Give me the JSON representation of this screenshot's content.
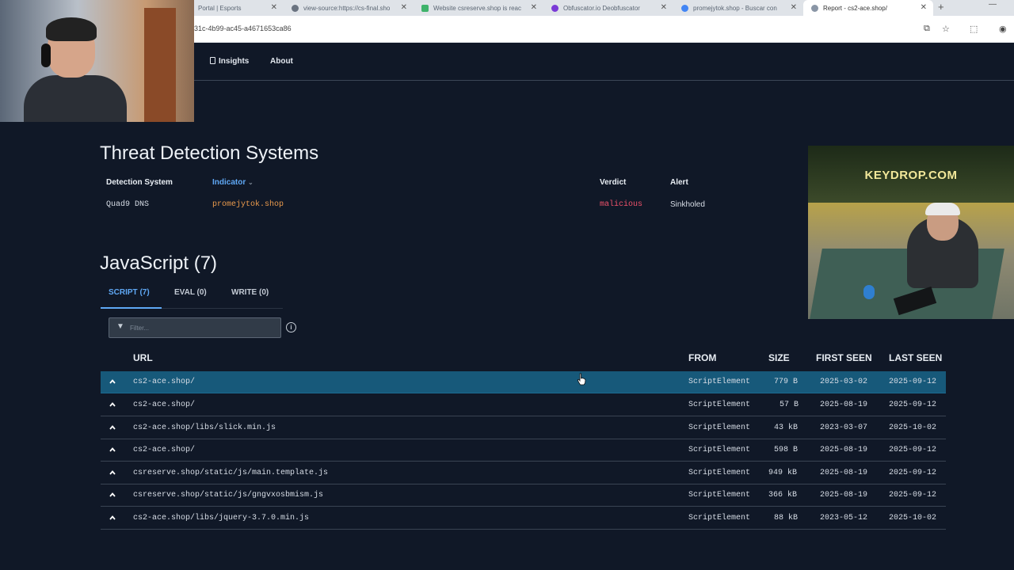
{
  "browser": {
    "tabs": [
      {
        "title": "Portal | Esports",
        "favicon_color": "#d9dde2"
      },
      {
        "title": "view-source:https://cs-final.sho",
        "favicon_color": "#6a7380"
      },
      {
        "title": "Website csreserve.shop is reac",
        "favicon_color": "#3fb36b"
      },
      {
        "title": "Obfuscator.io Deobfuscator",
        "favicon_color": "#7a3ad6"
      },
      {
        "title": "promejytok.shop - Buscar con",
        "favicon_color": "#4285f4"
      },
      {
        "title": "Report - cs2-ace.shop/",
        "favicon_color": "#8a96a6"
      }
    ],
    "new_tab_glyph": "+",
    "minimize_glyph": "—",
    "url": "31c-4b99-ac45-a4671653ca86"
  },
  "sitenav": {
    "items": [
      {
        "label": "Insights"
      },
      {
        "label": "About"
      }
    ]
  },
  "overlay": {
    "brand_text": "KEYDROP.COM"
  },
  "threat": {
    "title": "Threat Detection Systems",
    "headers": {
      "system": "Detection System",
      "indicator": "Indicator",
      "verdict": "Verdict",
      "alert": "Alert"
    },
    "rows": [
      {
        "system": "Quad9 DNS",
        "indicator": "promejytok.shop",
        "verdict": "malicious",
        "alert": "Sinkholed"
      }
    ]
  },
  "javascript": {
    "title": "JavaScript (7)",
    "tabs": [
      {
        "label": "SCRIPT (7)",
        "active": true
      },
      {
        "label": "EVAL (0)",
        "active": false
      },
      {
        "label": "WRITE (0)",
        "active": false
      }
    ],
    "filter_placeholder": "Filter...",
    "info_glyph": "i",
    "columns": {
      "url": "URL",
      "from": "FROM",
      "size": "SIZE",
      "first_seen": "FIRST SEEN",
      "last_seen": "LAST SEEN"
    },
    "rows": [
      {
        "url": "cs2-ace.shop/",
        "from": "ScriptElement",
        "size": "779 B",
        "first_seen": "2025-03-02",
        "last_seen": "2025-09-12",
        "selected": true
      },
      {
        "url": "cs2-ace.shop/",
        "from": "ScriptElement",
        "size": "57 B",
        "first_seen": "2025-08-19",
        "last_seen": "2025-09-12",
        "selected": false
      },
      {
        "url": "cs2-ace.shop/libs/slick.min.js",
        "from": "ScriptElement",
        "size": "43 kB",
        "first_seen": "2023-03-07",
        "last_seen": "2025-10-02",
        "selected": false
      },
      {
        "url": "cs2-ace.shop/",
        "from": "ScriptElement",
        "size": "598 B",
        "first_seen": "2025-08-19",
        "last_seen": "2025-09-12",
        "selected": false
      },
      {
        "url": "csreserve.shop/static/js/main.template.js",
        "from": "ScriptElement",
        "size": "949 kB",
        "first_seen": "2025-08-19",
        "last_seen": "2025-09-12",
        "selected": false
      },
      {
        "url": "csreserve.shop/static/js/gngvxosbmism.js",
        "from": "ScriptElement",
        "size": "366 kB",
        "first_seen": "2025-08-19",
        "last_seen": "2025-09-12",
        "selected": false
      },
      {
        "url": "cs2-ace.shop/libs/jquery-3.7.0.min.js",
        "from": "ScriptElement",
        "size": "88 kB",
        "first_seen": "2023-05-12",
        "last_seen": "2025-10-02",
        "selected": false
      }
    ]
  },
  "colors": {
    "background": "#101827",
    "accent": "#5fa8f5",
    "selected_row": "#17597a",
    "malicious": "#f0526b",
    "indicator": "#ea9a4c"
  }
}
